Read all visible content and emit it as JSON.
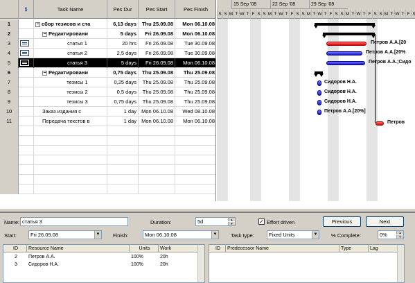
{
  "columns": {
    "id": "",
    "indicators": "ℹ",
    "task_name": "Task Name",
    "duration": "Pes Dur",
    "start": "Pes Start",
    "finish": "Pes Finish"
  },
  "rows": [
    {
      "id": "1",
      "name": "сбор тезисов и ста",
      "duration": "6,13 days",
      "start": "Thu 25.09.08",
      "finish": "Mon 06.10.08",
      "summary": true,
      "level": 0,
      "note": false,
      "selected": false
    },
    {
      "id": "2",
      "name": "Редактировани",
      "duration": "5 days",
      "start": "Fri 26.09.08",
      "finish": "Mon 06.10.08",
      "summary": true,
      "level": 1,
      "note": false,
      "selected": false
    },
    {
      "id": "3",
      "name": "статья 1",
      "duration": "20 hrs",
      "start": "Fri 26.09.08",
      "finish": "Tue 30.09.08",
      "summary": false,
      "level": 2,
      "note": true,
      "selected": false
    },
    {
      "id": "4",
      "name": "статья 2",
      "duration": "2,5 days",
      "start": "Fri 26.09.08",
      "finish": "Tue 30.09.08",
      "summary": false,
      "level": 2,
      "note": true,
      "selected": false
    },
    {
      "id": "5",
      "name": "статья 3",
      "duration": "5 days",
      "start": "Fri 26.09.08",
      "finish": "Mon 06.10.08",
      "summary": false,
      "level": 2,
      "note": true,
      "selected": true
    },
    {
      "id": "6",
      "name": "Редактировани",
      "duration": "0,75 days",
      "start": "Thu 25.09.08",
      "finish": "Thu 25.09.08",
      "summary": true,
      "level": 1,
      "note": false,
      "selected": false
    },
    {
      "id": "7",
      "name": "тезисы 1",
      "duration": "0,25 days",
      "start": "Thu 25.09.08",
      "finish": "Thu 25.09.08",
      "summary": false,
      "level": 2,
      "note": false,
      "selected": false
    },
    {
      "id": "8",
      "name": "тезисы 2",
      "duration": "0,5 days",
      "start": "Thu 25.09.08",
      "finish": "Thu 25.09.08",
      "summary": false,
      "level": 2,
      "note": false,
      "selected": false
    },
    {
      "id": "9",
      "name": "тезисы 3",
      "duration": "0,75 days",
      "start": "Thu 25.09.08",
      "finish": "Thu 25.09.08",
      "summary": false,
      "level": 2,
      "note": false,
      "selected": false
    },
    {
      "id": "10",
      "name": "Заказ издания с",
      "duration": "1 day",
      "start": "Mon 06.10.08",
      "finish": "Wed 08.10.08",
      "summary": false,
      "level": 1,
      "note": false,
      "selected": false
    },
    {
      "id": "11",
      "name": "Передача текстов в",
      "duration": "1 day",
      "start": "Mon 06.10.08",
      "finish": "Mon 06.10.08",
      "summary": false,
      "level": 1,
      "note": false,
      "selected": false
    }
  ],
  "gantt": {
    "weeks": [
      "15 Sep '08",
      "22 Sep '08",
      "29 Sep '08"
    ],
    "days": [
      "S",
      "S",
      "M",
      "T",
      "W",
      "T",
      "F",
      "S",
      "S",
      "M",
      "T",
      "W",
      "T",
      "F",
      "S",
      "S",
      "M",
      "T",
      "W",
      "T",
      "F",
      "S",
      "S",
      "M",
      "T",
      "W",
      "T",
      "F",
      "S",
      "S",
      "M",
      "T",
      "W",
      "T",
      "F",
      "S"
    ],
    "bar_labels": [
      "Петров А.А.[20",
      "Петров А.А.[20%",
      "Петров А.А.;Сидо",
      "Сидоров Н.А.",
      "Сидоров Н.А.",
      "Сидоров Н.А.",
      "Петров А.А.[20%]",
      "Петров"
    ],
    "colors": {
      "critical": "#e00000",
      "normal": "#1818c8",
      "summary": "#000000"
    }
  },
  "form": {
    "name_label": "Name:",
    "name_value": "статья 3",
    "duration_label": "Duration:",
    "duration_value": "5d",
    "effort_label": "Effort driven",
    "effort_checked": "✓",
    "previous_label": "Previous",
    "next_label": "Next",
    "start_label": "Start:",
    "start_value": "Fri 26.09.08",
    "finish_label": "Finish:",
    "finish_value": "Mon 06.10.08",
    "task_type_label": "Task type:",
    "task_type_value": "Fixed Units",
    "complete_label": "% Complete:",
    "complete_value": "0%",
    "res_columns": [
      "ID",
      "Resource Name",
      "Units",
      "Work"
    ],
    "resources": [
      {
        "id": "2",
        "name": "Петров А.А.",
        "units": "100%",
        "work": "20h"
      },
      {
        "id": "3",
        "name": "Сидоров Н.А.",
        "units": "100%",
        "work": "20h"
      }
    ],
    "pred_columns": [
      "ID",
      "Predecessor Name",
      "Type",
      "Lag"
    ]
  }
}
